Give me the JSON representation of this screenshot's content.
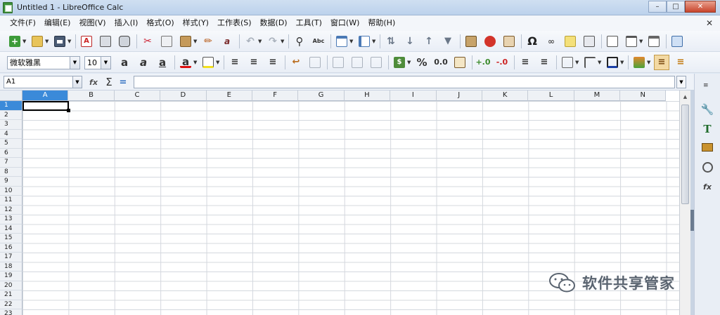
{
  "window": {
    "title": "Untitled 1 - LibreOffice Calc"
  },
  "menu": [
    "文件(F)",
    "编辑(E)",
    "视图(V)",
    "插入(I)",
    "格式(O)",
    "样式(Y)",
    "工作表(S)",
    "数据(D)",
    "工具(T)",
    "窗口(W)",
    "帮助(H)"
  ],
  "format_toolbar": {
    "font_name": "微软雅黑",
    "font_size": "10",
    "percent_label": "%",
    "decimal_label": "0.0"
  },
  "formula_bar": {
    "name_box": "A1",
    "formula": ""
  },
  "columns": [
    "A",
    "B",
    "C",
    "D",
    "E",
    "F",
    "G",
    "H",
    "I",
    "J",
    "K",
    "L",
    "M",
    "N"
  ],
  "rows": [
    "1",
    "2",
    "3",
    "4",
    "5",
    "6",
    "7",
    "8",
    "9",
    "10",
    "11",
    "12",
    "13",
    "14",
    "15",
    "16",
    "17",
    "18",
    "19",
    "20",
    "21",
    "22",
    "23"
  ],
  "selected_cell": "A1",
  "icons": {
    "standard_toolbar": [
      "new-icon",
      "open-icon",
      "save-icon",
      "export-pdf-icon",
      "print-icon",
      "print-preview-icon",
      "cut-icon",
      "copy-icon",
      "paste-icon",
      "clone-format-icon",
      "clear-format-icon",
      "undo-icon",
      "redo-icon",
      "find-replace-icon",
      "spellcheck-icon",
      "row-icon",
      "column-icon",
      "sort-icon",
      "sort-ascending-icon",
      "sort-descending-icon",
      "autofilter-icon",
      "image-icon",
      "chart-icon",
      "pivot-table-icon",
      "special-character-icon",
      "hyperlink-icon",
      "comment-icon",
      "header-footer-icon",
      "define-print-area-icon",
      "freeze-rows-icon",
      "split-window-icon",
      "show-draw-functions-icon"
    ],
    "sidebar": [
      "sidebar-menu-icon",
      "properties-icon",
      "styles-icon",
      "gallery-icon",
      "navigator-icon",
      "functions-icon"
    ]
  },
  "watermark": {
    "text": "软件共享管家"
  },
  "colors": {
    "selection": "#3b8ad9",
    "grid": "#d4d8de",
    "chrome": "#dfe9f5"
  }
}
